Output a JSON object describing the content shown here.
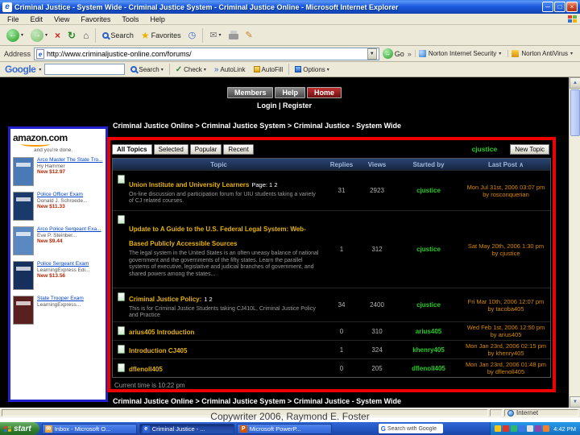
{
  "window": {
    "title": "Criminal Justice - System Wide - Criminal Justice System - Criminal Justice Online - Microsoft Internet Explorer",
    "menus": [
      "File",
      "Edit",
      "View",
      "Favorites",
      "Tools",
      "Help"
    ]
  },
  "toolbar": {
    "search_label": "Search",
    "favorites_label": "Favorites"
  },
  "address_bar": {
    "label": "Address",
    "url": "http://www.criminaljustice-online.com/forums/",
    "go_label": "Go",
    "norton_is": "Norton Internet Security",
    "norton_av": "Norton AntiVirus"
  },
  "google_bar": {
    "logo": "Google",
    "search_value": "",
    "buttons": [
      "Search",
      "Check",
      "AutoLink",
      "AutoFill",
      "Options"
    ]
  },
  "site": {
    "nav_buttons": [
      "Members",
      "Help",
      "Home"
    ],
    "login_register": "Login | Register",
    "breadcrumb": "Criminal Justice Online > Criminal Justice System > Criminal Justice - System Wide",
    "footer_breadcrumb": "Criminal Justice Online > Criminal Justice System > Criminal Justice - System Wide",
    "current_time": "Current time is 10:22 pm"
  },
  "amazon": {
    "logo": "amazon.com",
    "tagline": "and you're done.",
    "items": [
      {
        "title": "Arco Master The State Tro...",
        "author": "Hy Hammer",
        "price": "New $12.97",
        "cover": "#4a7ab5"
      },
      {
        "title": "Police Officer Exam",
        "author": "Donald J. Schroede...",
        "price": "New $11.33",
        "cover": "#1a3a6b"
      },
      {
        "title": "Arco Police Sergeant Exa...",
        "author": "Eve P. Steinber...",
        "price": "New $9.44",
        "cover": "#5a88c0"
      },
      {
        "title": "Police Sergeant Exam",
        "author": "LearningExpress Edi...",
        "price": "New $13.56",
        "cover": "#16305e"
      },
      {
        "title": "State Trooper Exam",
        "author": "LearningExpress...",
        "price": "",
        "cover": "#5a2020"
      }
    ]
  },
  "forum": {
    "tabs": [
      "All Topics",
      "Selected",
      "Popular",
      "Recent"
    ],
    "user": "cjustice",
    "new_topic": "New Topic",
    "columns": [
      "Topic",
      "Replies",
      "Views",
      "Started by",
      "Last Post"
    ],
    "sort_indicator": "∧",
    "rows": [
      {
        "title": "Union Institute and University Learners",
        "pages": "Page: 1 2",
        "desc": "On-line discussion and participation forum for UIU students taking a variety of CJ related courses.",
        "replies": "31",
        "views": "2923",
        "started_by": "cjustice",
        "last_post_date": "Mon Jul 31st, 2006 03:07 pm",
        "last_post_by": "by rosconquerian"
      },
      {
        "title": "Update to A Guide to the U.S. Federal Legal System: Web-Based Publicly Accessible Sources",
        "pages": "",
        "desc": "The legal system in the United States is an often uneasy balance of national government and the governments of the fifty states. Learn the parallel systems of executive, legislative and judicial branches of government, and shared powers among the states...",
        "replies": "1",
        "views": "312",
        "started_by": "cjustice",
        "last_post_date": "Sat May 20th, 2006 1:30 pm",
        "last_post_by": "by cjustice"
      },
      {
        "title": "Criminal Justice Policy:",
        "pages": "1 2",
        "desc": "This is for Criminal Justice Students taking CJ410L, Criminal Justice Policy and Practice",
        "replies": "34",
        "views": "2400",
        "started_by": "cjustice",
        "last_post_date": "Fri Mar 10th, 2006 12:07 pm",
        "last_post_by": "by tacoba405"
      },
      {
        "title": "arius405 Introduction",
        "pages": "",
        "desc": "",
        "replies": "0",
        "views": "310",
        "started_by": "arius405",
        "last_post_date": "Wed Feb 1st, 2006 12:50 pm",
        "last_post_by": "by arius405"
      },
      {
        "title": "Introduction CJ405",
        "pages": "",
        "desc": "",
        "replies": "1",
        "views": "324",
        "started_by": "khenry405",
        "last_post_date": "Mon Jan 23rd, 2006 02:15 pm",
        "last_post_by": "by khenry405"
      },
      {
        "title": "dflenoll405",
        "pages": "",
        "desc": "",
        "replies": "0",
        "views": "205",
        "started_by": "dflenoll405",
        "last_post_date": "Mon Jan 23rd, 2006 01:48 pm",
        "last_post_by": "by dflenoll405"
      }
    ]
  },
  "status_bar": {
    "zone": "Internet"
  },
  "slide": {
    "copyright": "Copywriter 2006, Raymond E. Foster"
  },
  "taskbar": {
    "start_label": "start",
    "windows": [
      {
        "label": "Inbox - Microsoft O..."
      },
      {
        "label": "Criminal Justice - ..."
      },
      {
        "label": "Microsoft PowerP..."
      }
    ],
    "deskbar": "Search with Google",
    "clock": "4:42 PM"
  },
  "colors": {
    "topic_title": "#e7b400",
    "username_green": "#22cc22",
    "last_post_orange": "#d98a00",
    "highlight_red_border": "#ee0000",
    "highlight_blue_border": "#2222cc",
    "taskbar_blue": "#2456c2",
    "xp_title_blue": "#1c5ae0"
  },
  "icons": {
    "minimize": "─",
    "maximize": "□",
    "close": "×",
    "back": "←",
    "forward": "→",
    "dropdown": "▾",
    "stop": "×",
    "refresh": "↻",
    "home": "⌂",
    "favorites": "★",
    "history": "◷",
    "mail": "✉",
    "edit": "✎",
    "check": "✓",
    "chevron": "»",
    "up": "▲",
    "down": "▼",
    "go": "→",
    "ie": "e",
    "powerpoint": "P",
    "g": "G"
  }
}
